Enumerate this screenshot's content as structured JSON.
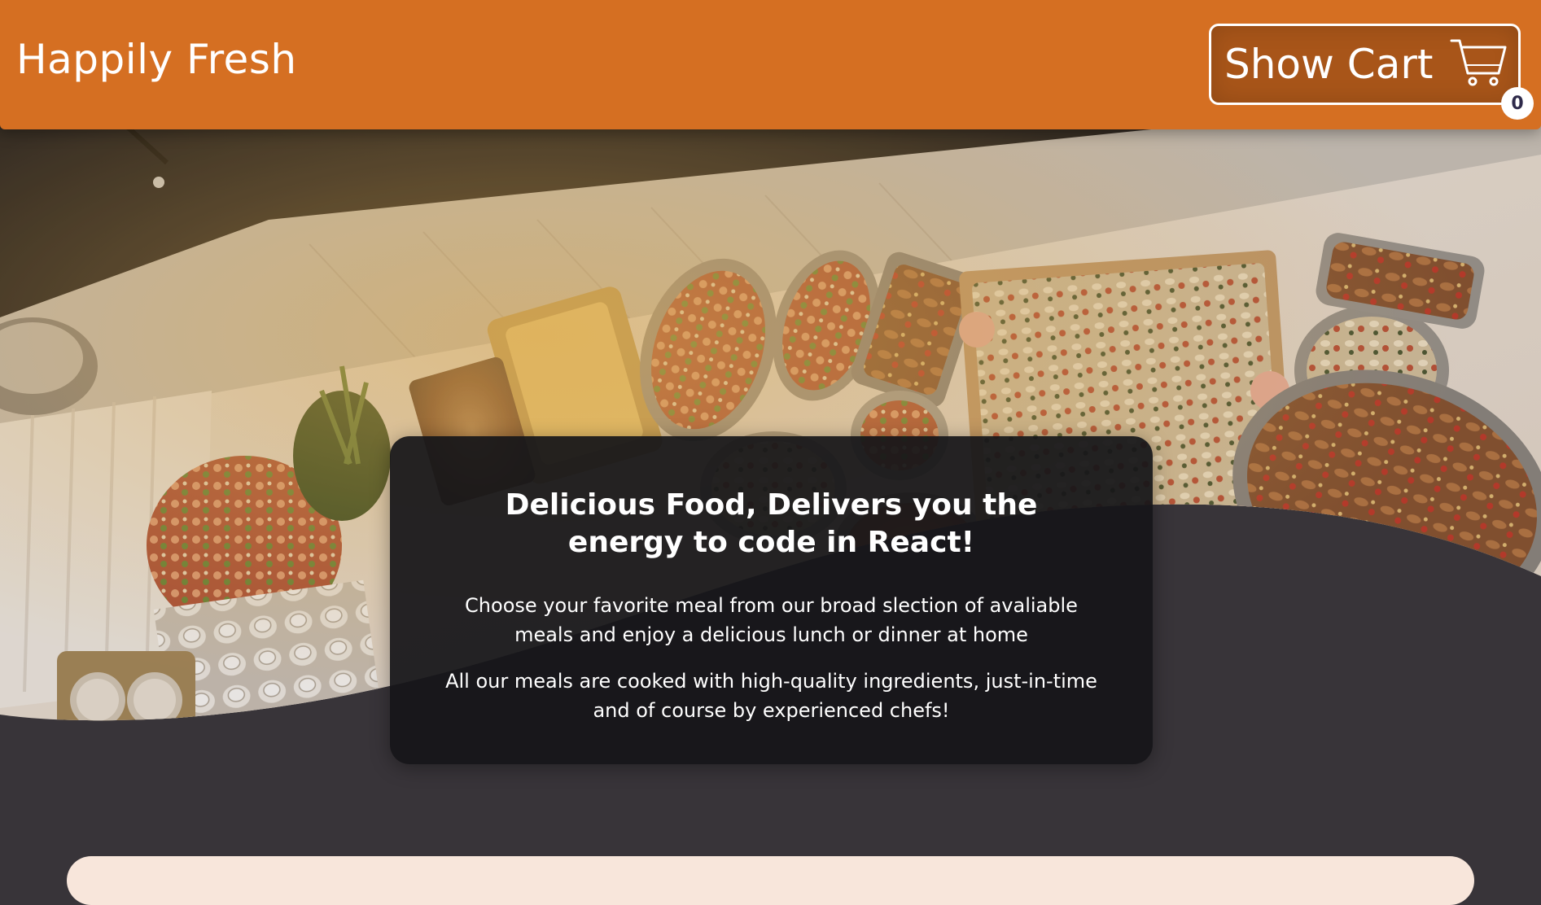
{
  "header": {
    "brand": "Happily Fresh",
    "cart": {
      "label": "Show Cart",
      "icon": "cart-icon",
      "count": "0"
    }
  },
  "hero": {
    "image": "buffet-food-banner",
    "card": {
      "title": "Delicious Food, Delivers you the energy to code in React!",
      "paragraph1": "Choose your favorite meal from our broad slection of avaliable meals and enjoy a delicious lunch or dinner at home",
      "paragraph2": "All our meals are cooked with high-quality ingredients, just-in-time and of course by experienced chefs!"
    }
  },
  "colors": {
    "header": "#d56f22",
    "background": "#383439",
    "card": "#161619",
    "meals_panel": "#f8e6db"
  }
}
